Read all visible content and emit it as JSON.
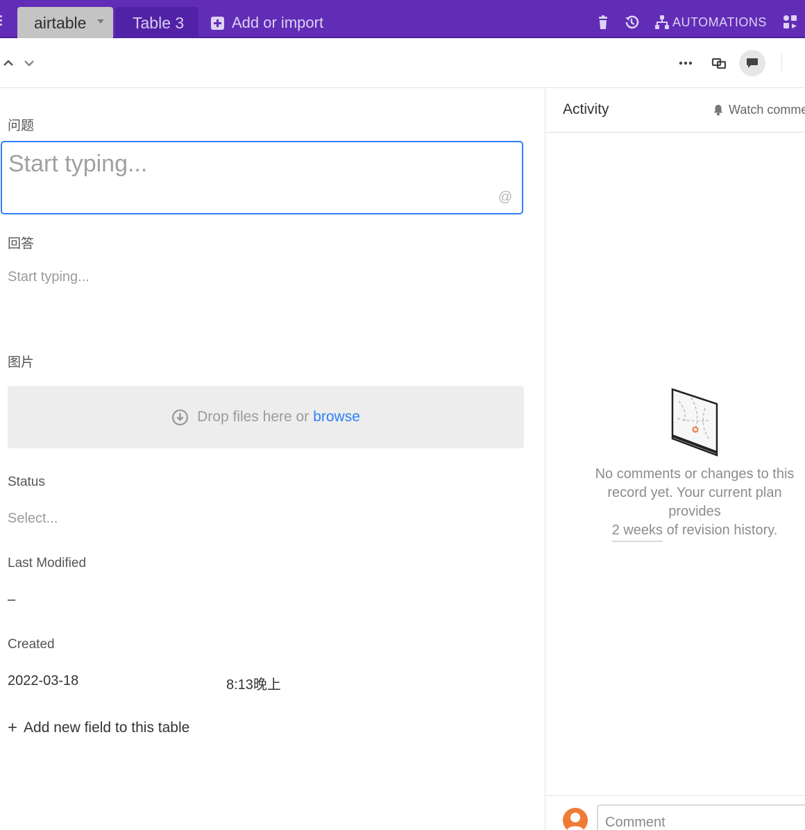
{
  "topbar": {
    "base_name": "airtable",
    "table_tab": "Table 3",
    "add_import": "Add or import",
    "automations": "AUTOMATIONS"
  },
  "fields": {
    "question": {
      "label": "问题",
      "placeholder": "Start typing...",
      "mention": "@"
    },
    "answer": {
      "label": "回答",
      "placeholder": "Start typing..."
    },
    "image": {
      "label": "图片",
      "drop_text": "Drop files here or",
      "browse": "browse"
    },
    "status": {
      "label": "Status",
      "placeholder": "Select..."
    },
    "last_modified": {
      "label": "Last Modified",
      "value": "–"
    },
    "created": {
      "label": "Created",
      "date": "2022-03-18",
      "time": "8:13晚上"
    }
  },
  "add_field": "Add new field to this table",
  "activity": {
    "title": "Activity",
    "watch": "Watch comme",
    "empty_message": "No comments or changes to this record yet. Your current plan provides",
    "empty_link": "2 weeks",
    "empty_suffix": " of revision history.",
    "comment_placeholder": "Comment"
  },
  "colors": {
    "topbar": "#612cb6",
    "accent": "#2d7ff9",
    "avatar": "#ef7b37"
  },
  "icons": [
    "grip-icon",
    "dropdown-caret-icon",
    "add-box-icon",
    "trash-icon",
    "history-icon",
    "automations-icon",
    "apps-icon",
    "chevron-up-icon",
    "chevron-down-icon",
    "more-icon",
    "expand-record-icon",
    "comment-icon",
    "download-icon",
    "plus-icon",
    "bell-icon",
    "avatar-icon"
  ]
}
